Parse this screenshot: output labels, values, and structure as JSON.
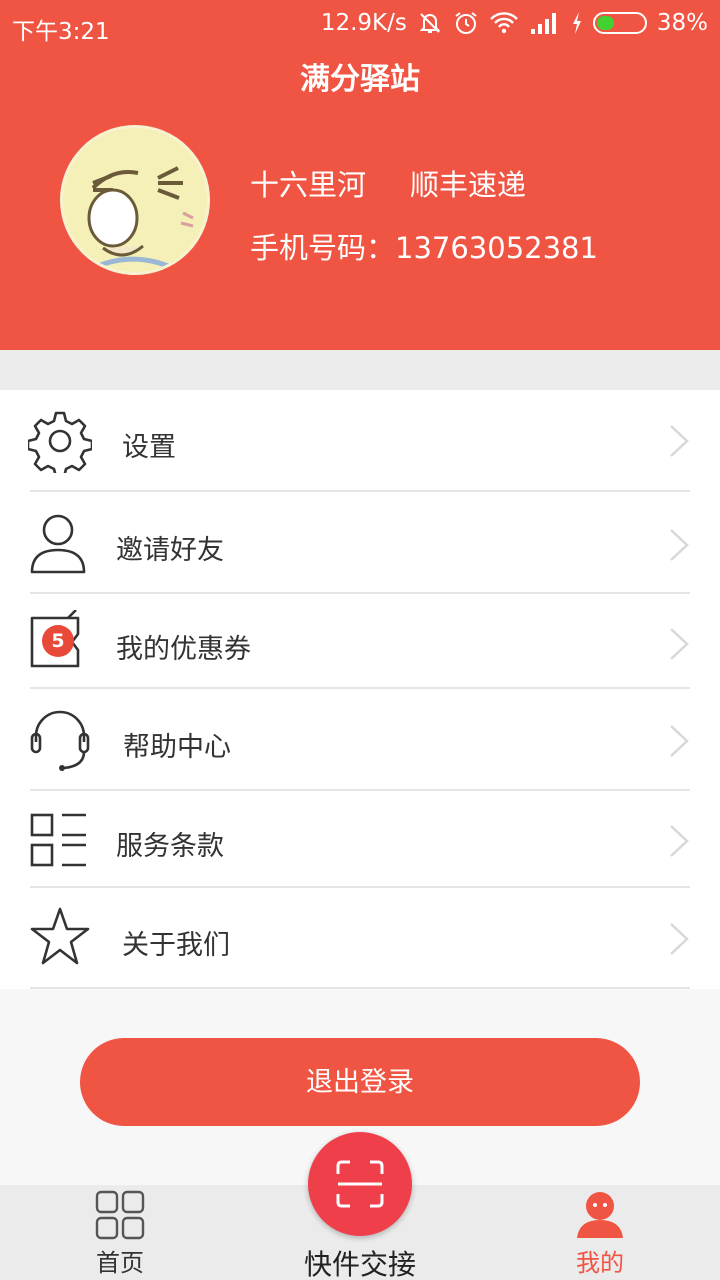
{
  "status_bar": {
    "time": "下午3:21",
    "speed": "12.9K/s",
    "battery": "38%",
    "battery_level": 0.38
  },
  "header": {
    "title": "满分驿站",
    "user": {
      "location": "十六里河",
      "courier": "顺丰速递",
      "phone_line": "手机号码：13763052381"
    }
  },
  "menu": {
    "items": [
      {
        "label": "设置",
        "icon": "gear-icon"
      },
      {
        "label": "邀请好友",
        "icon": "person-icon"
      },
      {
        "label": "我的优惠券",
        "icon": "coupon-icon",
        "badge": "5"
      },
      {
        "label": "帮助中心",
        "icon": "headset-icon"
      },
      {
        "label": "服务条款",
        "icon": "list-icon"
      },
      {
        "label": "关于我们",
        "icon": "star-icon"
      }
    ]
  },
  "logout_label": "退出登录",
  "tabs": {
    "home": {
      "label": "首页",
      "icon": "grid-icon"
    },
    "scan": {
      "label": "快件交接",
      "icon": "scan-icon"
    },
    "mine": {
      "label": "我的",
      "icon": "user-icon",
      "active": true
    }
  },
  "colors": {
    "accent": "#f05543",
    "scan_button": "#ee3f4b",
    "badge": "#e84938"
  }
}
